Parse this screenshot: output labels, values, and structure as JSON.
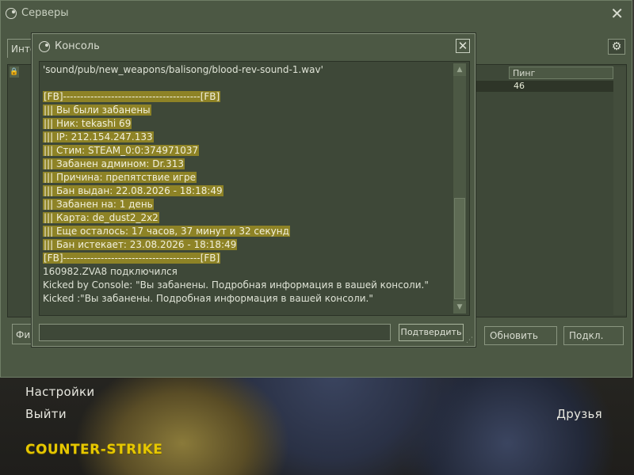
{
  "servers_window": {
    "title": "Серверы",
    "tab_partial": "Инте",
    "ping_header": "Пинг",
    "ping_value": "46",
    "filter_partial": "Фи",
    "refresh_label": "Обновить",
    "connect_label": "Подкл."
  },
  "console": {
    "title": "Консоль",
    "lines": [
      {
        "text": "'sound/pub/new_weapons/balisong/blood-rev-sound-1.wav'",
        "hl": false
      },
      {
        "text": "",
        "hl": false
      },
      {
        "text": "[FB]----------------------------------------[FB]",
        "hl": true
      },
      {
        "text": "||| Вы были забанены",
        "hl": true
      },
      {
        "text": "||| Ник: tekashi 69",
        "hl": true
      },
      {
        "text": "||| IP: 212.154.247.133",
        "hl": true
      },
      {
        "text": "||| Стим: STEAM_0:0:374971037",
        "hl": true
      },
      {
        "text": "||| Забанен админом: Dr.313",
        "hl": true
      },
      {
        "text": "||| Причина: препятствие игре",
        "hl": true
      },
      {
        "text": "||| Бан выдан: 22.08.2026 - 18:18:49",
        "hl": true
      },
      {
        "text": "||| Забанен на: 1 день",
        "hl": true
      },
      {
        "text": "||| Карта: de_dust2_2x2",
        "hl": true
      },
      {
        "text": "||| Еще осталось: 17 часов, 37 минут и 32 секунд",
        "hl": true
      },
      {
        "text": "||| Бан истекает: 23.08.2026 - 18:18:49",
        "hl": true
      },
      {
        "text": "[FB]----------------------------------------[FB]",
        "hl": true
      },
      {
        "text": "160982.ZVA8 подключился",
        "hl": false
      },
      {
        "text": "Kicked by Console: \"Вы забанены. Подробная информация в вашей консоли.\"",
        "hl": false
      },
      {
        "text": "Kicked :\"Вы забанены. Подробная информация в вашей консоли.\"",
        "hl": false
      }
    ],
    "input_value": "",
    "submit_label": "Подтвердить"
  },
  "menu": {
    "settings": "Настройки",
    "exit": "Выйти",
    "friends": "Друзья",
    "logo": "COUNTER-STRIKE"
  },
  "colors": {
    "window_bg": "#4c5844",
    "panel_bg": "#3e4838",
    "highlight": "#8e8326",
    "logo": "#e6c700"
  }
}
